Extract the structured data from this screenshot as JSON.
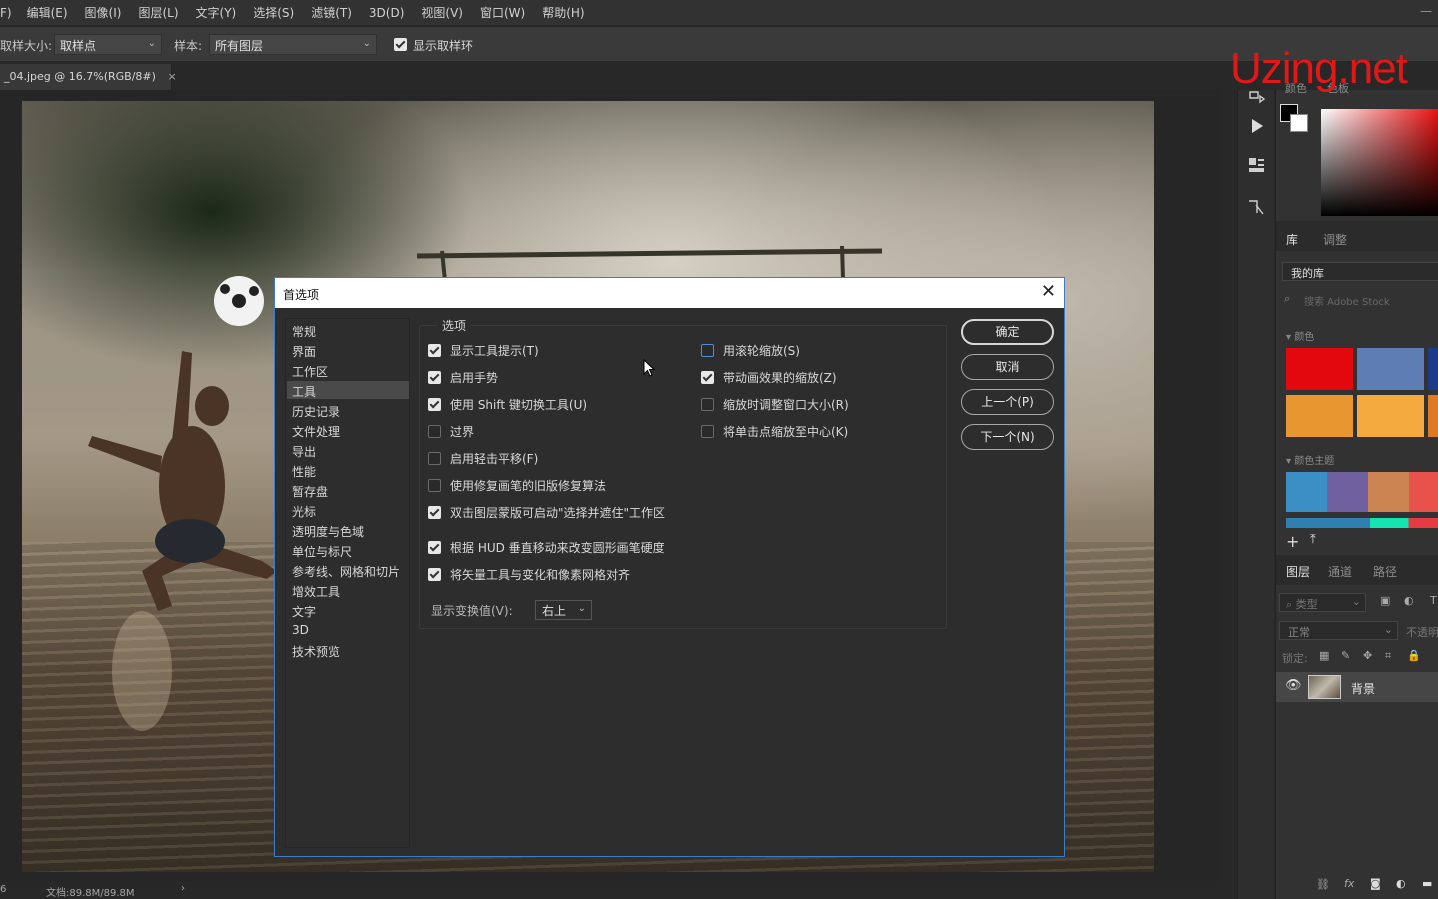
{
  "menubar": {
    "items": [
      "F)",
      "编辑(E)",
      "图像(I)",
      "图层(L)",
      "文字(Y)",
      "选择(S)",
      "滤镜(T)",
      "3D(D)",
      "视图(V)",
      "窗口(W)",
      "帮助(H)"
    ],
    "minimize": "—"
  },
  "options": {
    "sample_size_label": "取样大小:",
    "sample_size_value": "取样点",
    "sample_label": "样本:",
    "sample_value": "所有图层",
    "show_ring_label": "显示取样环"
  },
  "document": {
    "tab_title": "_04.jpeg @ 16.7%(RGB/8#)",
    "tab_close": "×",
    "status_text": "文档:89.8M/89.8M",
    "status_arrow": "›",
    "status_left": "6"
  },
  "watermark": "Uzing.net",
  "right_panel": {
    "color_tabs": [
      "颜色",
      "色板"
    ],
    "library_tabs": [
      "库",
      "调整"
    ],
    "library_select": "我的库",
    "library_search_placeholder": "搜索 Adobe Stock",
    "colors_section": "颜色",
    "color_theme_section": "颜色主题",
    "swatches": [
      "#e3080e",
      "#5f7db5",
      "#1b3a8a",
      "#e8962f",
      "#f5aa3f",
      "#e07a22"
    ],
    "theme_colors": [
      "#3c8fc4",
      "#70609f",
      "#cc8552",
      "#e8524a"
    ],
    "layer_tabs": [
      "图层",
      "通道",
      "路径"
    ],
    "layer_filter": "类型",
    "blend_mode": "正常",
    "opacity_label": "不透明",
    "lock_label": "锁定:",
    "layer_name": "背景"
  },
  "dialog": {
    "title": "首选项",
    "close": "✕",
    "nav_items": [
      "常规",
      "界面",
      "工作区",
      "工具",
      "历史记录",
      "文件处理",
      "导出",
      "性能",
      "暂存盘",
      "光标",
      "透明度与色域",
      "单位与标尺",
      "参考线、网格和切片",
      "增效工具",
      "文字",
      "3D",
      "技术预览"
    ],
    "active_nav": "工具",
    "group_title": "选项",
    "left_options": [
      {
        "label": "显示工具提示(T)",
        "checked": true
      },
      {
        "label": "启用手势",
        "checked": true
      },
      {
        "label": "使用 Shift 键切换工具(U)",
        "checked": true
      },
      {
        "label": "过界",
        "checked": false
      },
      {
        "label": "启用轻击平移(F)",
        "checked": false
      },
      {
        "label": "使用修复画笔的旧版修复算法",
        "checked": false
      },
      {
        "label": "双击图层蒙版可启动\"选择并遮住\"工作区",
        "checked": true
      },
      {
        "label": "根据 HUD 垂直移动来改变圆形画笔硬度",
        "checked": true
      },
      {
        "label": "将矢量工具与变化和像素网格对齐",
        "checked": true
      }
    ],
    "right_options": [
      {
        "label": "用滚轮缩放(S)",
        "checked": false
      },
      {
        "label": "带动画效果的缩放(Z)",
        "checked": true
      },
      {
        "label": "缩放时调整窗口大小(R)",
        "checked": false
      },
      {
        "label": "将单击点缩放至中心(K)",
        "checked": false
      }
    ],
    "transform_label": "显示变换值(V):",
    "transform_value": "右上",
    "buttons": {
      "ok": "确定",
      "cancel": "取消",
      "prev": "上一个(P)",
      "next": "下一个(N)"
    }
  }
}
